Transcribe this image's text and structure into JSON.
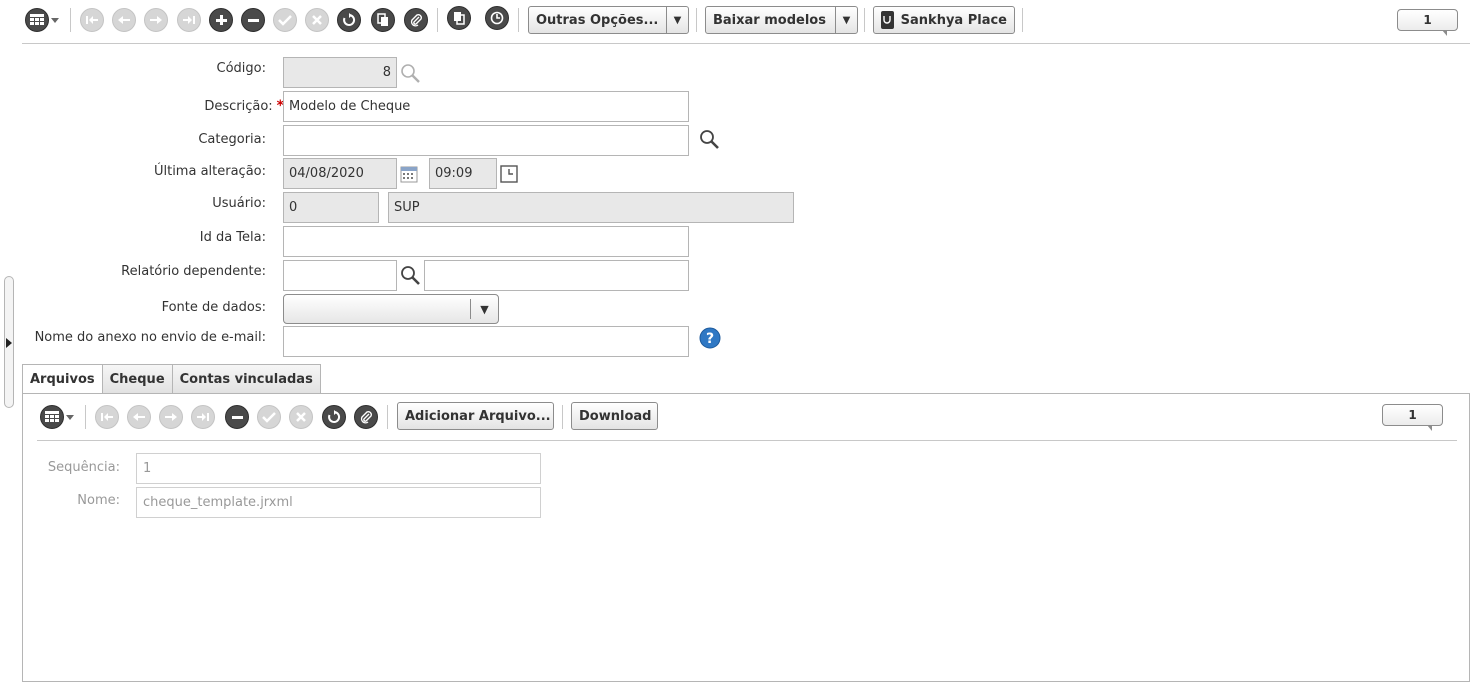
{
  "toolbar": {
    "more_options_label": "Outras Opções...",
    "download_models_label": "Baixar modelos",
    "place_label": "Sankhya Place",
    "page_number": "1"
  },
  "form": {
    "codigo": {
      "label": "Código:",
      "value": "8"
    },
    "descricao": {
      "label": "Descrição:",
      "required_mark": "*",
      "value": "Modelo de Cheque"
    },
    "categoria": {
      "label": "Categoria:",
      "value": ""
    },
    "ultima_alteracao": {
      "label": "Última alteração:",
      "date": "04/08/2020",
      "time": "09:09"
    },
    "usuario": {
      "label": "Usuário:",
      "code": "0",
      "name": "SUP"
    },
    "id_tela": {
      "label": "Id da Tela:",
      "value": ""
    },
    "relatorio_dependente": {
      "label": "Relatório dependente:",
      "code": "",
      "name": ""
    },
    "fonte_dados": {
      "label": "Fonte de dados:",
      "value": ""
    },
    "nome_anexo": {
      "label": "Nome do anexo no envio de e-mail:",
      "value": ""
    }
  },
  "tabs": [
    {
      "label": "Arquivos",
      "active": true
    },
    {
      "label": "Cheque",
      "active": false
    },
    {
      "label": "Contas vinculadas",
      "active": false
    }
  ],
  "subtoolbar": {
    "add_file_label": "Adicionar Arquivo...",
    "download_label": "Download",
    "page_number": "1"
  },
  "files": {
    "sequencia": {
      "label": "Sequência:",
      "value": "1"
    },
    "nome": {
      "label": "Nome:",
      "value": "cheque_template.jrxml"
    }
  },
  "icons": {
    "grid": "grid-icon",
    "first": "first-record-icon",
    "prev": "previous-record-icon",
    "next": "next-record-icon",
    "last": "last-record-icon",
    "add": "add-icon",
    "remove": "remove-icon",
    "save": "save-icon",
    "cancel": "cancel-icon",
    "refresh": "refresh-icon",
    "copy": "copy-icon",
    "attach": "attach-icon",
    "search": "search-icon",
    "calendar": "calendar-icon",
    "clock": "clock-icon",
    "help": "help-icon"
  },
  "colors": {
    "required": "#cc0000",
    "help": "#2f78c4",
    "disabled": "#d6d6d6",
    "active": "#4a4a4a"
  }
}
